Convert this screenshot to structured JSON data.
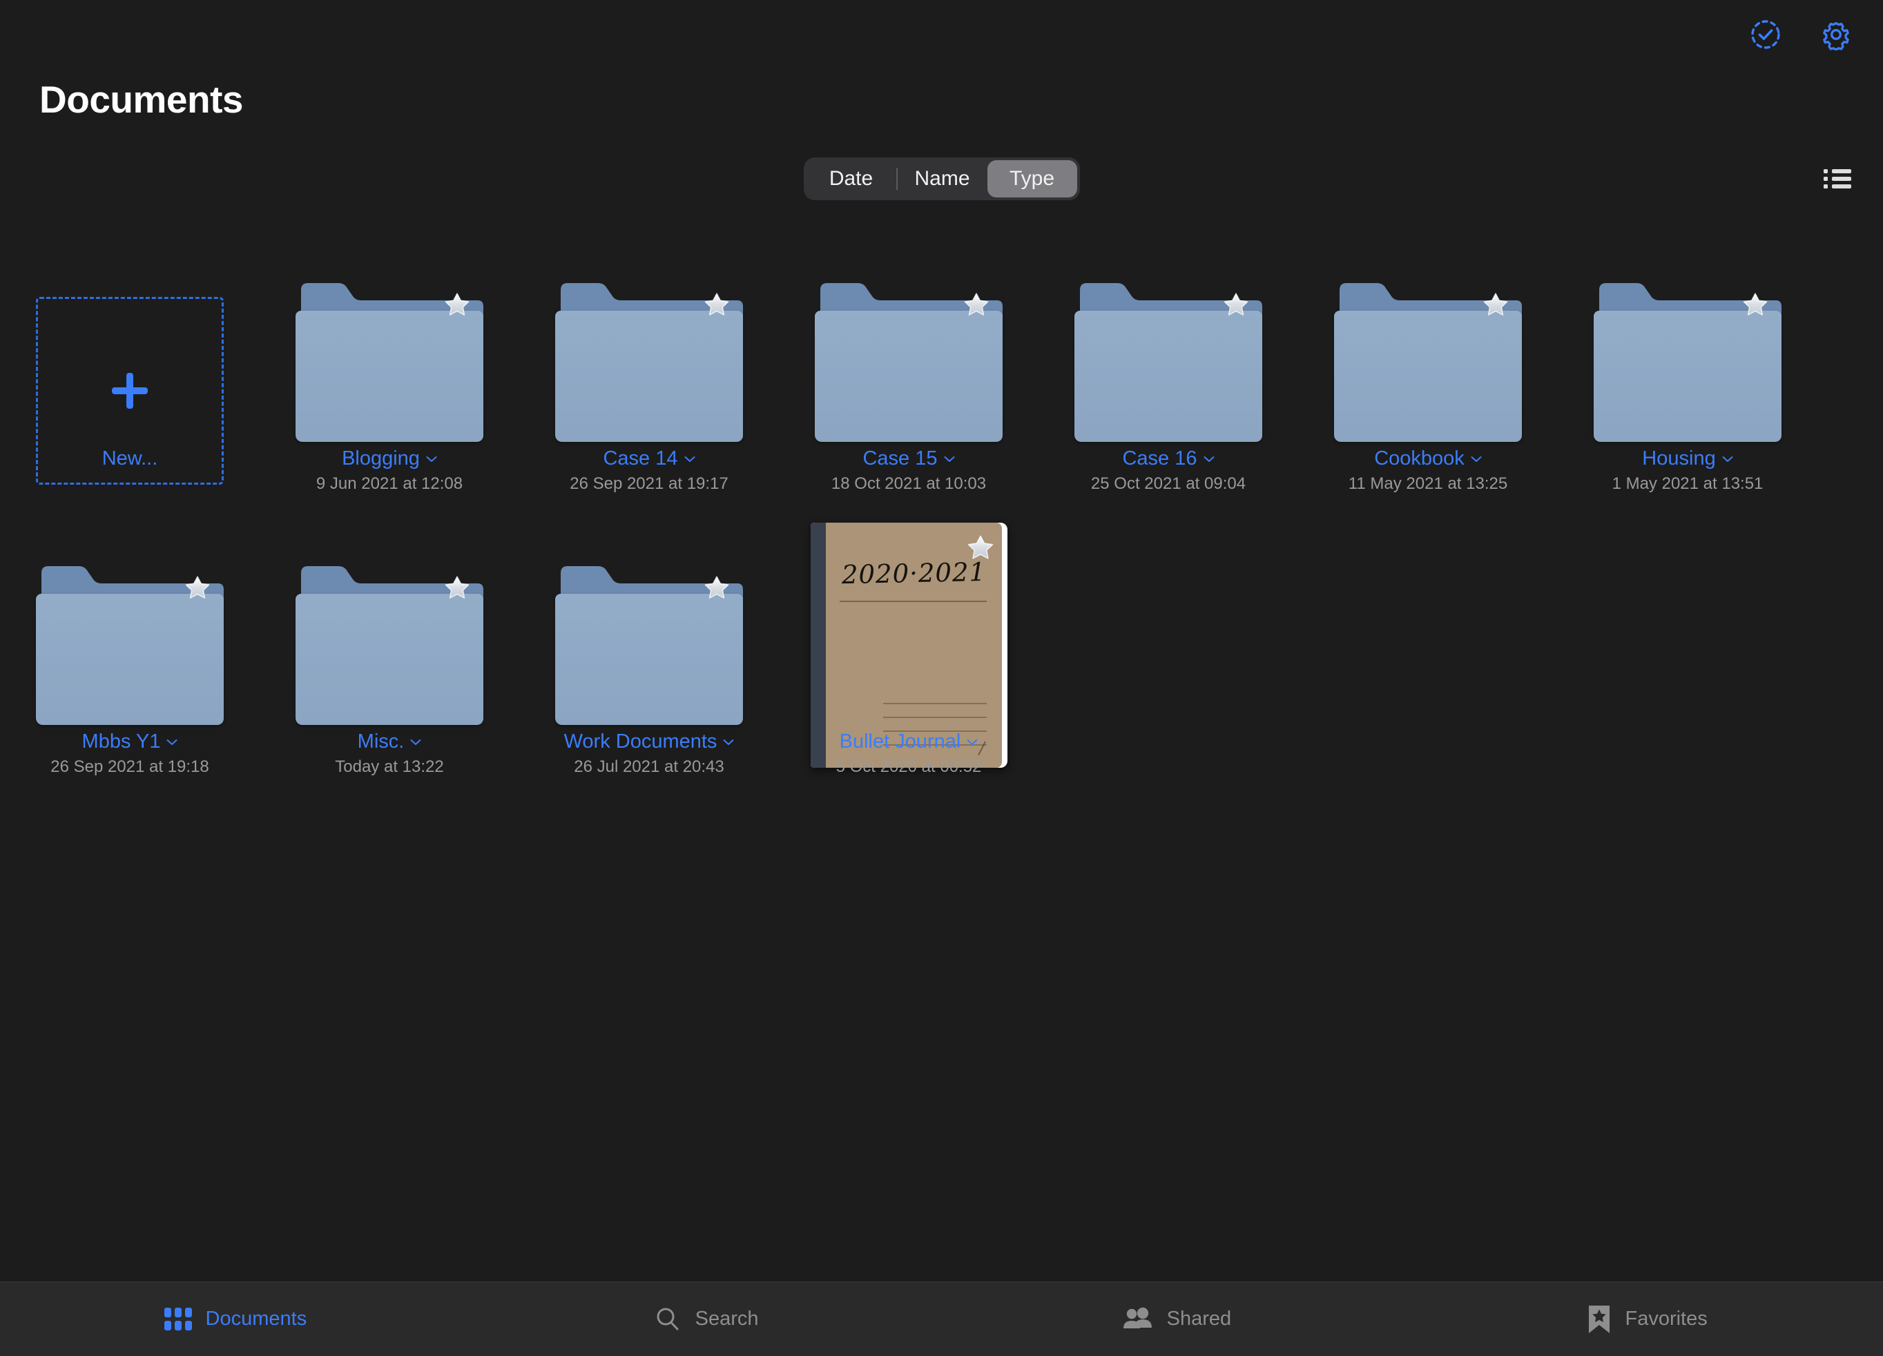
{
  "header": {
    "title": "Documents",
    "select_icon": "dashed-circle-check-icon",
    "settings_icon": "gear-icon"
  },
  "sort": {
    "options": [
      "Date",
      "Name",
      "Type"
    ],
    "selected": "Type",
    "list_view_icon": "list-view-icon"
  },
  "new_tile": {
    "label": "New...",
    "icon": "plus-icon"
  },
  "items": [
    {
      "name": "Blogging",
      "date": "9 Jun 2021 at 12:08",
      "kind": "folder",
      "favorite": true
    },
    {
      "name": "Case 14",
      "date": "26 Sep 2021 at 19:17",
      "kind": "folder",
      "favorite": true
    },
    {
      "name": "Case 15",
      "date": "18 Oct 2021 at 10:03",
      "kind": "folder",
      "favorite": true
    },
    {
      "name": "Case 16",
      "date": "25 Oct 2021 at 09:04",
      "kind": "folder",
      "favorite": true
    },
    {
      "name": "Cookbook",
      "date": "11 May 2021 at 13:25",
      "kind": "folder",
      "favorite": true
    },
    {
      "name": "Housing",
      "date": "1 May 2021 at 13:51",
      "kind": "folder",
      "favorite": true
    },
    {
      "name": "Mbbs Y1",
      "date": "26 Sep 2021 at 19:18",
      "kind": "folder",
      "favorite": true
    },
    {
      "name": "Misc.",
      "date": "Today at 13:22",
      "kind": "folder",
      "favorite": true
    },
    {
      "name": "Work Documents",
      "date": "26 Jul 2021 at 20:43",
      "kind": "folder",
      "favorite": true
    },
    {
      "name": "Bullet Journal",
      "date": "5 Oct 2020 at 00:52",
      "kind": "journal",
      "favorite": true,
      "cover_title": "2020·2021"
    }
  ],
  "tabs": [
    {
      "label": "Documents",
      "icon": "grid-icon",
      "active": true
    },
    {
      "label": "Search",
      "icon": "search-icon",
      "active": false
    },
    {
      "label": "Shared",
      "icon": "people-icon",
      "active": false
    },
    {
      "label": "Favorites",
      "icon": "bookmark-star-icon",
      "active": false
    }
  ],
  "colors": {
    "background": "#1c1c1c",
    "accent": "#3b7dfb",
    "tabbar": "#2a2a2a",
    "folder_front": "#8ba5c2",
    "folder_back": "#6d8bb0",
    "journal_cover": "#ab9477",
    "journal_spine": "#3a414e",
    "secondary_text": "#9a9a9a"
  }
}
